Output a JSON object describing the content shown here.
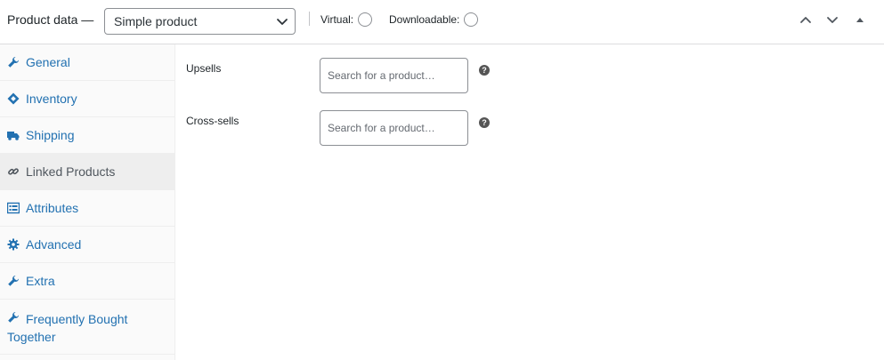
{
  "header": {
    "title": "Product data —",
    "product_type": {
      "selected": "Simple product",
      "icon": "chevron-down-icon"
    },
    "virtual_label": "Virtual:",
    "downloadable_label": "Downloadable:",
    "buttons": {
      "move_up": "chevron-up-icon",
      "move_down": "chevron-down-icon",
      "toggle": "triangle-up-icon"
    }
  },
  "sidebar": {
    "items": [
      {
        "label": "General",
        "icon": "wrench-icon"
      },
      {
        "label": "Inventory",
        "icon": "tag-icon"
      },
      {
        "label": "Shipping",
        "icon": "truck-icon"
      },
      {
        "label": "Linked Products",
        "icon": "link-icon",
        "active": true
      },
      {
        "label": "Attributes",
        "icon": "list-icon"
      },
      {
        "label": "Advanced",
        "icon": "gear-icon"
      },
      {
        "label": "Extra",
        "icon": "wrench-icon"
      },
      {
        "label": "Frequently Bought Together",
        "icon": "wrench-icon"
      }
    ]
  },
  "linked": {
    "upsells": {
      "label": "Upsells",
      "placeholder": "Search for a product…"
    },
    "cross_sells": {
      "label": "Cross-sells",
      "placeholder": "Search for a product…"
    }
  },
  "colors": {
    "accent": "#2271b1",
    "active_tab_bg": "#eeeeee",
    "sidebar_bg": "#fafafa",
    "help_icon": "#555555"
  }
}
